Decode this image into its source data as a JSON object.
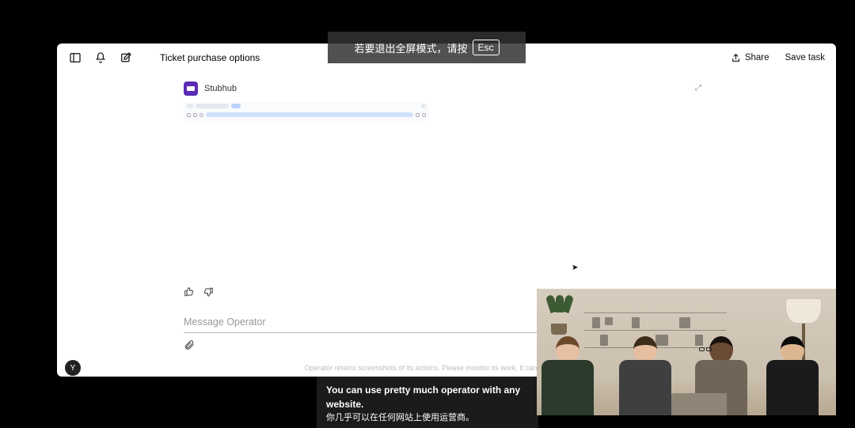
{
  "header": {
    "title": "Ticket purchase options",
    "share_label": "Share",
    "save_label": "Save task"
  },
  "browser_card": {
    "site_name": "Stubhub"
  },
  "input": {
    "placeholder": "Message Operator"
  },
  "footer": {
    "disclaimer": "Operator retains screenshots of its actions. Please monitor its work. It can make mistakes."
  },
  "avatar": {
    "initial": "Y"
  },
  "fullscreen_notice": {
    "text": "若要退出全屏模式，请按",
    "key": "Esc"
  },
  "subtitle": {
    "en": "You can use pretty much operator with any website.",
    "zh": "你几乎可以在任何网站上使用运营商。"
  }
}
